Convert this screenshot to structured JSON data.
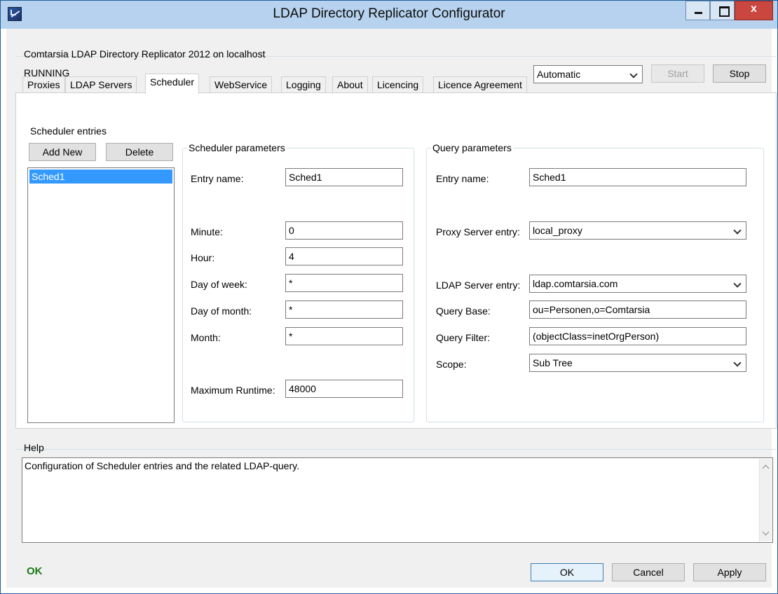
{
  "window": {
    "title": "LDAP Directory Replicator Configurator",
    "close_glyph": "x"
  },
  "service": {
    "group_label": "Comtarsia LDAP Directory Replicator 2012 on localhost",
    "status": "RUNNING",
    "startup_mode": "Automatic",
    "start_label": "Start",
    "stop_label": "Stop"
  },
  "tabs": [
    {
      "label": "Proxies"
    },
    {
      "label": "LDAP Servers"
    },
    {
      "label": "Scheduler"
    },
    {
      "label": "WebService"
    },
    {
      "label": "Logging"
    },
    {
      "label": "About"
    },
    {
      "label": "Licencing"
    },
    {
      "label": "Licence Agreement"
    }
  ],
  "active_tab": "Scheduler",
  "scheduler": {
    "entries_label": "Scheduler entries",
    "add_new_label": "Add New",
    "delete_label": "Delete",
    "entries": [
      "Sched1"
    ],
    "selected_entry": "Sched1"
  },
  "scheduler_params": {
    "group_label": "Scheduler parameters",
    "entry_name_label": "Entry name:",
    "entry_name": "Sched1",
    "minute_label": "Minute:",
    "minute": "0",
    "hour_label": "Hour:",
    "hour": "4",
    "day_of_week_label": "Day of week:",
    "day_of_week": "*",
    "day_of_month_label": "Day of month:",
    "day_of_month": "*",
    "month_label": "Month:",
    "month": "*",
    "max_runtime_label": "Maximum Runtime:",
    "max_runtime": "48000"
  },
  "query_params": {
    "group_label": "Query parameters",
    "entry_name_label": "Entry name:",
    "entry_name": "Sched1",
    "proxy_label": "Proxy Server entry:",
    "proxy_value": "local_proxy",
    "ldap_label": "LDAP Server entry:",
    "ldap_value": "ldap.comtarsia.com",
    "query_base_label": "Query Base:",
    "query_base": "ou=Personen,o=Comtarsia",
    "query_filter_label": "Query Filter:",
    "query_filter": "(objectClass=inetOrgPerson)",
    "scope_label": "Scope:",
    "scope_value": "Sub Tree"
  },
  "help": {
    "group_label": "Help",
    "text": "Configuration of Scheduler entries and the related LDAP-query."
  },
  "footer": {
    "status": "OK",
    "ok_label": "OK",
    "cancel_label": "Cancel",
    "apply_label": "Apply"
  }
}
